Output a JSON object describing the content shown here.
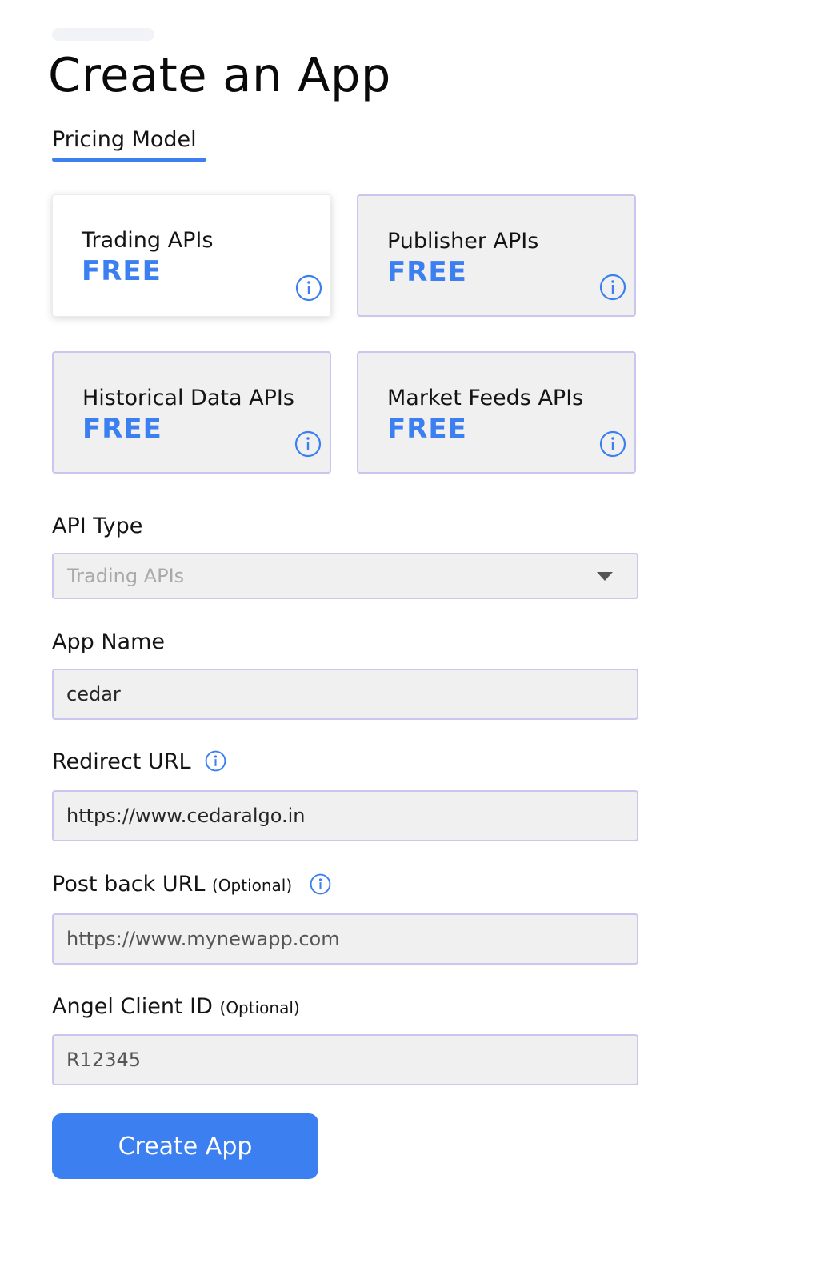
{
  "page": {
    "title": "Create an App"
  },
  "tabs": {
    "pricing_model": "Pricing Model"
  },
  "pricing_cards": [
    {
      "name": "Trading APIs",
      "price": "FREE",
      "selected": true,
      "icon": "info-icon"
    },
    {
      "name": "Publisher APIs",
      "price": "FREE",
      "selected": false,
      "icon": "info-icon"
    },
    {
      "name": "Historical Data APIs",
      "price": "FREE",
      "selected": false,
      "icon": "info-icon"
    },
    {
      "name": "Market Feeds APIs",
      "price": "FREE",
      "selected": false,
      "icon": "info-icon"
    }
  ],
  "form": {
    "api_type": {
      "label": "API Type",
      "selected": "Trading APIs"
    },
    "app_name": {
      "label": "App Name",
      "value": "cedar"
    },
    "redirect_url": {
      "label": "Redirect URL",
      "value": "https://www.cedaralgo.in",
      "icon": "info-icon"
    },
    "postback_url": {
      "label": "Post back URL",
      "optional": "(Optional)",
      "placeholder": "https://www.mynewapp.com",
      "icon": "info-icon"
    },
    "client_id": {
      "label": "Angel Client ID",
      "optional": "(Optional)",
      "placeholder": "R12345"
    }
  },
  "submit": {
    "label": "Create App"
  },
  "colors": {
    "accent": "#3b7ff0",
    "field_border": "#c9c6f0",
    "field_bg": "#f0f0f0"
  }
}
